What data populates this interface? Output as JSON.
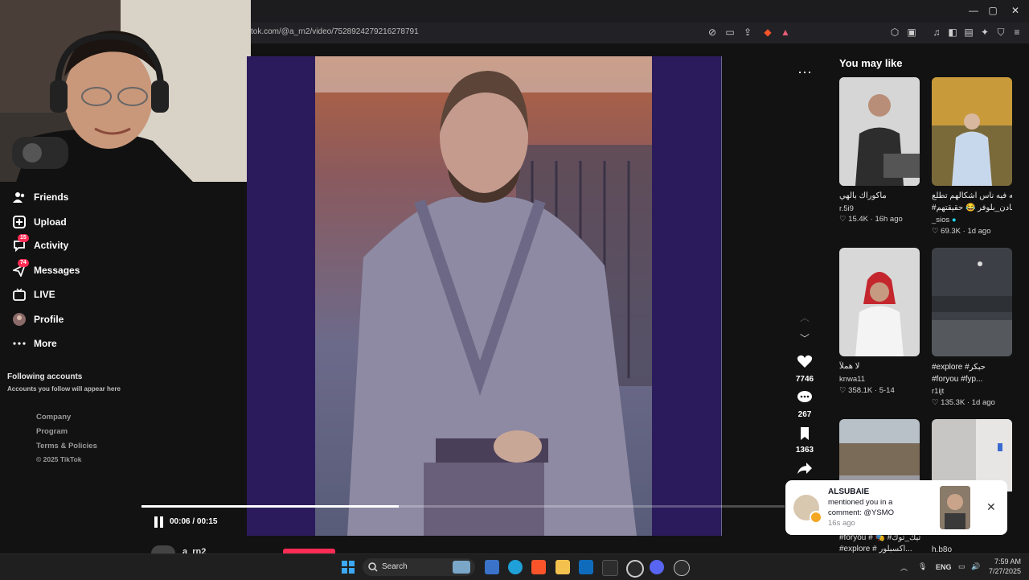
{
  "browser": {
    "url": "tok.com/@a_rn2/video/7528924279216278791",
    "window_controls": [
      "—",
      "▢",
      "✕"
    ]
  },
  "sidebar": {
    "items": [
      {
        "label": "Friends",
        "icon": "friends-icon"
      },
      {
        "label": "Upload",
        "icon": "upload-icon"
      },
      {
        "label": "Activity",
        "icon": "activity-icon",
        "badge": "15"
      },
      {
        "label": "Messages",
        "icon": "messages-icon",
        "badge": "74"
      },
      {
        "label": "LIVE",
        "icon": "live-icon"
      },
      {
        "label": "Profile",
        "icon": "profile-avatar"
      },
      {
        "label": "More",
        "icon": "more-dots-icon"
      }
    ],
    "following_title": "Following accounts",
    "following_subtitle": "Accounts you follow will appear here",
    "footer": [
      "Company",
      "Program",
      "Terms & Policies",
      "© 2025 TikTok"
    ]
  },
  "video": {
    "time": "00:06 / 00:15",
    "progress": 0.4,
    "likes": "7746",
    "comments": "267",
    "saves": "1363",
    "author_peek": "a_rn2"
  },
  "you_may_like": {
    "title": "You may like",
    "cards": [
      {
        "desc": "ماكوراك بالهي",
        "author": "r.5i9",
        "likes": "15.4K",
        "age": "16h ago"
      },
      {
        "desc": "والله فيه ناس اشكالهم تطلع",
        "desc2": "#شادن_بلوفر 😂 حقيقتهم...",
        "author": "_sios",
        "likes": "69.3K",
        "age": "1d ago"
      },
      {
        "desc": "لا هملآ",
        "author": "knwa11",
        "likes": "358.1K",
        "age": "5-14"
      },
      {
        "desc": "#explore #حبكر",
        "desc2": "#foryou #fyp...",
        "author": "r1ijt",
        "likes": "135.3K",
        "age": "1d ago"
      }
    ],
    "bottom_peek_left": "#foryou # 🎭 #تيك_توك",
    "bottom_peek_left2": "#explore # اكسبلور...",
    "bottom_peek_right": "h.b8o"
  },
  "notification": {
    "name": "ALSUBAIE",
    "message": "mentioned you in a comment: @YSMO",
    "time": "16s ago"
  },
  "taskbar": {
    "search": "Search",
    "lang": "ENG",
    "time": "7:59 AM",
    "date": "7/27/2025"
  }
}
